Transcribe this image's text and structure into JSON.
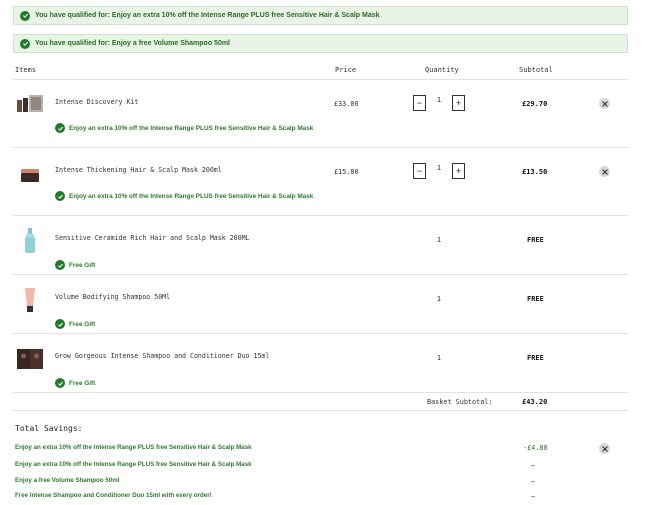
{
  "banners": [
    {
      "text": "You have qualified for: Enjoy an extra 10% off the Intense Range PLUS free Sensitive Hair & Scalp Mask"
    },
    {
      "text": "You have qualified for: Enjoy a free Volume Shampoo 50ml"
    }
  ],
  "table": {
    "headers": {
      "items": "Items",
      "price": "Price",
      "quantity": "Quantity",
      "subtotal": "Subtotal"
    },
    "rows": [
      {
        "name": "Intense Discovery Kit",
        "price": "£33.00",
        "qty": "1",
        "minus": "−",
        "plus": "+",
        "subtotal": "£29.70",
        "promo": "Enjoy an extra 10% off the Intense Range PLUS free Sensitive Hair & Scalp Mask",
        "thumb": "gift-set-icon"
      },
      {
        "name": "Intense Thickening Hair & Scalp Mask 200ml",
        "price": "£15.00",
        "qty": "1",
        "minus": "−",
        "plus": "+",
        "subtotal": "£13.50",
        "promo": "Enjoy an extra 10% off the Intense Range PLUS free Sensitive Hair & Scalp Mask",
        "thumb": "jar-icon"
      },
      {
        "name": "Sensitive Ceramide Rich Hair and Scalp Mask 200ML",
        "qty": "1",
        "subtotal": "FREE",
        "promo": "Free Gift",
        "thumb": "bottle-icon"
      },
      {
        "name": "Volume Bodifying Shampoo 50Ml",
        "qty": "1",
        "subtotal": "FREE",
        "promo": "Free Gift",
        "thumb": "tube-icon"
      },
      {
        "name": "Grow Gorgeous Intense Shampoo and Conditioner Duo 15ml",
        "qty": "1",
        "subtotal": "FREE",
        "promo": "Free Gift",
        "thumb": "duo-box-icon"
      }
    ],
    "basket_subtotal_label": "Basket Subtotal:",
    "basket_subtotal_value": "£43.20"
  },
  "savings": {
    "title": "Total Savings:",
    "items": [
      {
        "label": "Enjoy an extra 10% off the Intense Range PLUS free Sensitive Hair & Scalp Mask",
        "value": "-£4.80"
      },
      {
        "label": "Enjoy an extra 10% off the Intense Range PLUS free Sensitive Hair & Scalp Mask",
        "value": "–"
      },
      {
        "label": "Enjoy a free Volume Shampoo 50ml",
        "value": "–"
      },
      {
        "label": "Free Intense Shampoo and Conditioner Duo 15ml with every order!",
        "value": "–"
      }
    ]
  },
  "colors": {
    "accent_green": "#1f7a2c",
    "banner_bg": "#e7f4e6",
    "promo_text": "#2d7a2d"
  }
}
